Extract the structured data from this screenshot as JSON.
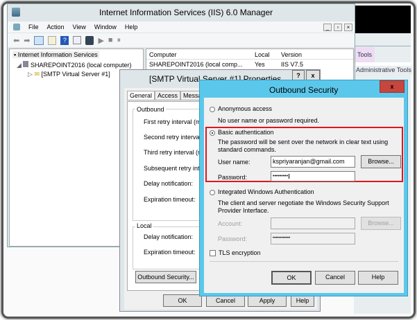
{
  "iis": {
    "title": "Internet Information Services (IIS) 6.0 Manager",
    "menu": [
      "File",
      "Action",
      "View",
      "Window",
      "Help"
    ],
    "tree": {
      "root": "Internet Information Services",
      "server": "SHAREPOINT2016 (local computer)",
      "smtp": "[SMTP Virtual Server #1]"
    },
    "list": {
      "headers": [
        "Computer",
        "Local",
        "Version"
      ],
      "rows": [
        [
          "SHAREPOINT2016 (local comp...",
          "Yes",
          "IIS V7.5"
        ]
      ]
    }
  },
  "background_app": {
    "tab": "Tools",
    "item": "Administrative Tools"
  },
  "properties": {
    "title": "[SMTP Virtual Server #1] Properties",
    "help_btn": "?",
    "close_btn": "x",
    "tabs": [
      "General",
      "Access",
      "Messages"
    ],
    "outbound_group": "Outbound",
    "outbound_labels": [
      "First retry interval (minutes):",
      "Second retry interval (minutes):",
      "Third retry interval (minutes):",
      "Subsequent retry interval (minutes):",
      "Delay notification:",
      "Expiration timeout:"
    ],
    "local_group": "Local",
    "local_labels": [
      "Delay notification:",
      "Expiration timeout:"
    ],
    "outbound_security_btn": "Outbound Security...",
    "buttons": {
      "ok": "OK",
      "cancel": "Cancel",
      "apply": "Apply",
      "help": "Help"
    }
  },
  "outbound": {
    "title": "Outbound Security",
    "close": "x",
    "anonymous": {
      "label": "Anonymous access",
      "desc": "No user name or password required.",
      "checked": false
    },
    "basic": {
      "label": "Basic authentication",
      "desc": "The password will be sent over the network in clear text using standard commands.",
      "checked": true,
      "user_label": "User name:",
      "user_value": "kspriyaranjan@gmail.com",
      "password_label": "Password:",
      "password_value": "•••••••••",
      "browse": "Browse..."
    },
    "integrated": {
      "label": "Integrated Windows Authentication",
      "desc": "The client and server negotiate the Windows Security Support Provider Interface.",
      "checked": false,
      "account_label": "Account:",
      "account_value": "",
      "password_label": "Password:",
      "password_value": "••••••••••••",
      "browse": "Browse..."
    },
    "tls": {
      "label": "TLS encryption",
      "checked": false
    },
    "buttons": {
      "ok": "OK",
      "cancel": "Cancel",
      "help": "Help"
    },
    "highlight_color": "#e0141e",
    "title_color": "#5bc8eb"
  }
}
